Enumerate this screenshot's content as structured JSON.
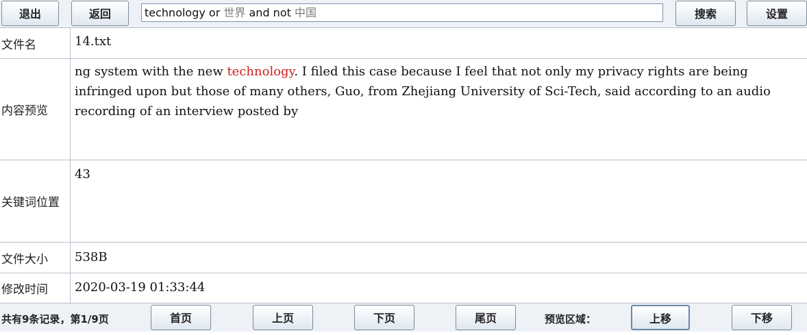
{
  "toolbar": {
    "exit_label": "退出",
    "back_label": "返回",
    "search_parts": [
      "technology or ",
      "世界",
      " and not ",
      "中国"
    ],
    "search_label": "搜索",
    "settings_label": "设置"
  },
  "details": {
    "filename_label": "文件名",
    "filename_value": "14.txt",
    "preview_label": "内容预览",
    "preview_before": "ng system with the new ",
    "preview_keyword": "technology",
    "preview_after": ". I filed this case because I feel that not only my privacy rights are being infringed upon but those of many others, Guo, from Zhejiang University of Sci-Tech, said according to an audio recording of an interview posted by",
    "keyword_position_label": "关键词位置",
    "keyword_position_value": "43",
    "filesize_label": "文件大小",
    "filesize_value": "538B",
    "modified_label": "修改时间",
    "modified_value": "2020-03-19 01:33:44"
  },
  "footer": {
    "record_summary": "共有9条记录，第1/9页",
    "first_page_label": "首页",
    "prev_page_label": "上页",
    "next_page_label": "下页",
    "last_page_label": "尾页",
    "preview_area_label": "预览区域：",
    "move_up_label": "上移",
    "move_down_label": "下移"
  }
}
